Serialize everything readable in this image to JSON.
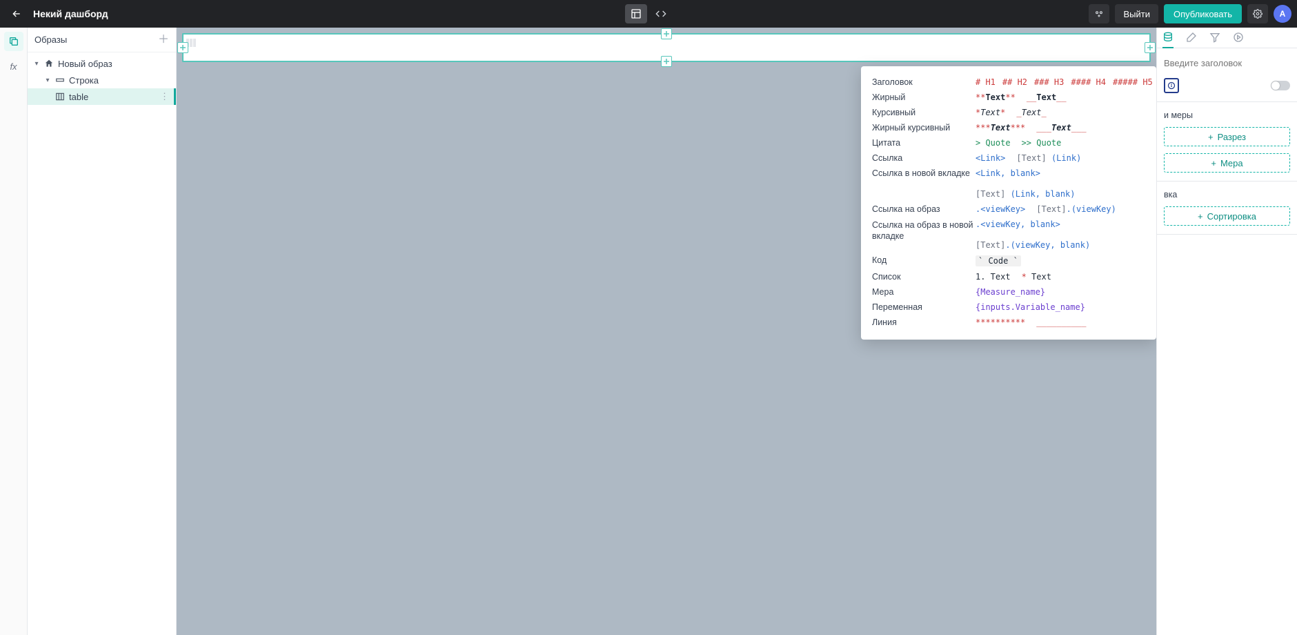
{
  "topbar": {
    "title": "Некий дашборд",
    "share": "",
    "logout": "Выйти",
    "publish": "Опубликовать",
    "avatar_letter": "A"
  },
  "left_panel": {
    "header": "Образы",
    "tree": {
      "root": "Новый образ",
      "row": "Строка",
      "table": "table",
      "dots": "⋮"
    }
  },
  "md": {
    "rows": {
      "heading": "Заголовок",
      "bold": "Жирный",
      "italic": "Курсивный",
      "bold_italic": "Жирный курсивный",
      "quote": "Цитата",
      "link": "Ссылка",
      "link_new": "Ссылка в новой вкладке",
      "link_view": "Ссылка на образ",
      "link_view_new": "Ссылка на образ в новой вкладке",
      "code": "Код",
      "list": "Список",
      "measure": "Мера",
      "variable": "Переменная",
      "line": "Линия"
    },
    "ex": {
      "h1": "# H1",
      "h2": "## H2",
      "h3": "### H3",
      "h4": "#### H4",
      "h5": "##### H5",
      "bold_a1": "**",
      "bold_a2": "Text",
      "bold_a3": "**",
      "bold_b1": "__",
      "bold_b2": "Text",
      "bold_b3": "__",
      "italic_a1": "*",
      "italic_a2": "Text",
      "italic_a3": "*",
      "italic_b1": "_",
      "italic_b2": "Text",
      "italic_b3": "_",
      "bi_a1": "***",
      "bi_a2": "Text",
      "bi_a3": "***",
      "bi_b1": "___",
      "bi_b2": "Text",
      "bi_b3": "___",
      "quote_a": "> Quote",
      "quote_b": ">> Quote",
      "link_a": "<Link>",
      "link_b1": "[Text]",
      "link_b2": " (Link)",
      "link_new_a": "<Link, blank>",
      "link_new_b1": "[Text]",
      "link_new_b2": " (Link, blank)",
      "link_view_a": ".<viewKey>",
      "link_view_b1": "[Text]",
      "link_view_b2": ".(viewKey)",
      "link_view_new_a": ".<viewKey, blank>",
      "link_view_new_b1": "[Text]",
      "link_view_new_b2": ".(viewKey, blank)",
      "code_chip": "` Code `",
      "list_a": "1. Text",
      "list_b1": "* ",
      "list_b2": "Text",
      "measure_ex": "{Measure_name}",
      "variable_ex": "{inputs.Variable_name}",
      "line_a": "**********",
      "line_b": "__________"
    }
  },
  "right_panel": {
    "title_placeholder": "Введите заголовок",
    "section_measures": "и меры",
    "btn_razrez": "Разрез",
    "btn_mera": "Мера",
    "section_sort": "вка",
    "btn_sort": "Сортировка"
  }
}
